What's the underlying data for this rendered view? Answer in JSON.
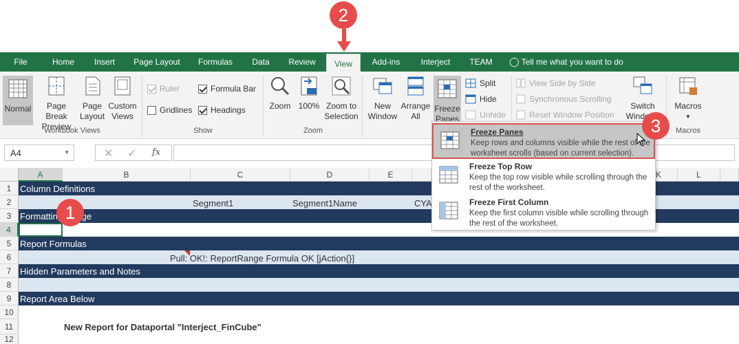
{
  "colors": {
    "excel_green": "#217346",
    "dark_band": "#223a5e",
    "light_band": "#dce6f1",
    "callout_red": "#e74c4c",
    "highlight_red": "#d9534f"
  },
  "tabs": [
    "File",
    "Home",
    "Insert",
    "Page Layout",
    "Formulas",
    "Data",
    "Review",
    "View",
    "Add-ins",
    "Interject",
    "TEAM"
  ],
  "active_tab": "View",
  "tell_me": "Tell me what you want to do",
  "ribbon": {
    "workbook_views": {
      "label": "Workbook Views",
      "normal": "Normal",
      "page_break_1": "Page Break",
      "page_break_2": "Preview",
      "page_layout_1": "Page",
      "page_layout_2": "Layout",
      "custom_1": "Custom",
      "custom_2": "Views"
    },
    "show": {
      "label": "Show",
      "ruler": "Ruler",
      "formula_bar": "Formula Bar",
      "gridlines": "Gridlines",
      "headings": "Headings"
    },
    "zoom": {
      "label": "Zoom",
      "zoom": "Zoom",
      "hundred": "100%",
      "zoom_sel_1": "Zoom to",
      "zoom_sel_2": "Selection"
    },
    "window": {
      "new_1": "New",
      "new_2": "Window",
      "arrange_1": "Arrange",
      "arrange_2": "All",
      "freeze_1": "Freeze",
      "freeze_2": "Panes",
      "split": "Split",
      "hide": "Hide",
      "unhide": "Unhide",
      "side_by_side": "View Side by Side",
      "sync_scroll": "Synchronous Scrolling",
      "reset_pos": "Reset Window Position",
      "switch_1": "Switch",
      "switch_2": "Windows"
    },
    "macros": {
      "label": "Macros",
      "btn": "Macros"
    }
  },
  "formula_bar": {
    "name_box": "A4",
    "fx": "fx",
    "content": ""
  },
  "columns": [
    "A",
    "B",
    "C",
    "D",
    "E",
    "K",
    "L"
  ],
  "rows": [
    "1",
    "2",
    "3",
    "4",
    "5",
    "6",
    "7",
    "8",
    "9",
    "10",
    "11",
    "12"
  ],
  "cells": {
    "r1": "Column Definitions",
    "r2_c": "Segment1",
    "r2_d": "Segment1Name",
    "r2_e": "CYA",
    "r3": "Formatting Range",
    "r5": "Report Formulas",
    "r6": "Pull: OK!: ReportRange Formula OK [jAction{}]",
    "r7": "Hidden Parameters and Notes",
    "r9": "Report Area Below",
    "r11": "New Report for Dataportal \"Interject_FinCube\""
  },
  "dropdown": {
    "items": [
      {
        "title": "Freeze Panes",
        "desc": "Keep rows and columns visible while the rest of the worksheet scrolls (based on current selection)."
      },
      {
        "title": "Freeze Top Row",
        "desc": "Keep the top row visible while scrolling through the rest of the worksheet."
      },
      {
        "title": "Freeze First Column",
        "desc": "Keep the first column visible while scrolling through the rest of the worksheet."
      }
    ]
  },
  "callouts": [
    "1",
    "2",
    "3"
  ]
}
